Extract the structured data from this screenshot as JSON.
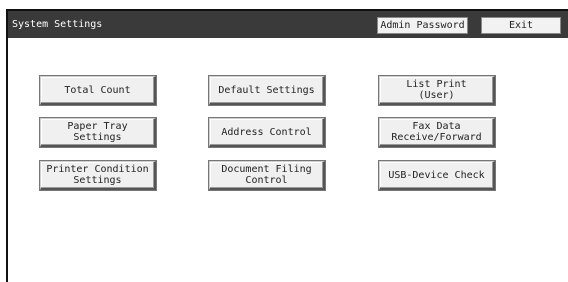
{
  "header": {
    "title": "System Settings",
    "admin_password_label": "Admin Password",
    "exit_label": "Exit"
  },
  "menu": [
    {
      "label": "Total Count"
    },
    {
      "label": "Default Settings"
    },
    {
      "label": "List Print\n(User)"
    },
    {
      "label": "Paper Tray\nSettings"
    },
    {
      "label": "Address Control"
    },
    {
      "label": "Fax Data\nReceive/Forward"
    },
    {
      "label": "Printer Condition\nSettings"
    },
    {
      "label": "Document Filing\nControl"
    },
    {
      "label": "USB-Device Check"
    }
  ],
  "colors": {
    "titlebar_bg": "#3a3a3a",
    "button_face": "#f0f0f0"
  }
}
